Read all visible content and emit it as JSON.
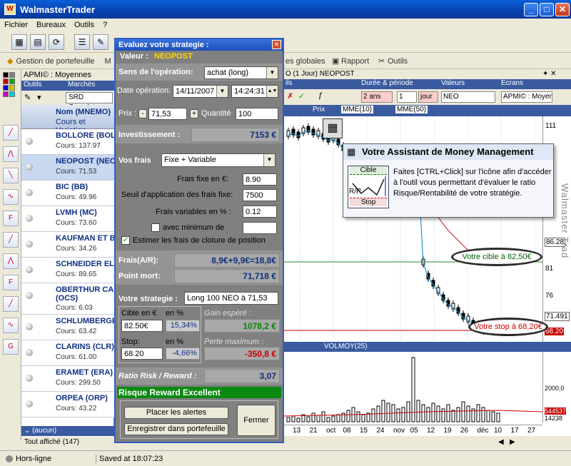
{
  "window": {
    "title": "WalmasterTrader"
  },
  "menu": [
    "Fichier",
    "Bureaux",
    "Outils",
    "?"
  ],
  "toolbar2": {
    "gestion": "Gestion de portefeuille",
    "m": "M",
    "vues": "es globales",
    "rapport": "Rapport",
    "outils": "Outils"
  },
  "list": {
    "header": "APMI© : Moyennes Mobiles (",
    "tabs": [
      "Outils",
      "Marchés"
    ],
    "market": "SRD Complet",
    "col1": "Nom (MNEMO)",
    "col2": "Cours et Variation",
    "rows": [
      {
        "name": "BOLLORE (BOL)",
        "cours": "Cours: 137.97"
      },
      {
        "name": "NEOPOST (NEO)",
        "cours": "Cours: 71.53"
      },
      {
        "name": "BIC (BB)",
        "cours": "Cours: 49.96"
      },
      {
        "name": "LVMH (MC)",
        "cours": "Cours: 73.60"
      },
      {
        "name": "KAUFMAN ET BRO",
        "cours": "Cours: 34.26"
      },
      {
        "name": "SCHNEIDER ELEC",
        "cours": "Cours: 89.65"
      },
      {
        "name": "OBERTHUR CARD",
        "name2": "(OCS)",
        "cours": "Cours: 6.03"
      },
      {
        "name": "SCHLUMBERGER",
        "cours": "Cours: 63.42"
      },
      {
        "name": "CLARINS (CLR)",
        "cours": "Cours: 61.00"
      },
      {
        "name": "ERAMET (ERA)",
        "cours": "Cours: 299.50"
      },
      {
        "name": "ORPEA (ORP)",
        "cours": "Cours: 43.22"
      }
    ],
    "footer_filter": "(aucun)",
    "footer_count": "Tout affiché (147)"
  },
  "status": {
    "connection": "Hors-ligne",
    "saved": "Saved at 18:07:23"
  },
  "chart": {
    "header": "O (1 Jour) NEOPOST",
    "tabs": [
      "ils",
      "Durée & période",
      "Valeurs",
      "Ecrans"
    ],
    "periode": "2 ans",
    "unit_value": "1",
    "unit": "jour",
    "valeur": "NEO",
    "ecran": "APMI© : Moyenne",
    "legend": [
      "Prix",
      "MME(10)",
      "MME(50)"
    ],
    "price_ticks": [
      "111",
      "86.28",
      "81",
      "76",
      "71.491",
      "68.20"
    ],
    "vol_label": "VOLMOY(25)",
    "vol_ticks": [
      "2000,0",
      "544537",
      "14238"
    ],
    "x_ticks": [
      "13",
      "21",
      "oct",
      "08",
      "15",
      "24",
      "nov",
      "05",
      "12",
      "19",
      "26",
      "déc",
      "10",
      "17",
      "27"
    ],
    "watermark": "Walmaster Trad",
    "cible_oval": "Votre cible à 82,50€",
    "stop_oval": "Votre stop à 68,20€"
  },
  "tooltip": {
    "title": "Votre Assistant de Money Management",
    "cible": "Cible",
    "rr": "R/R",
    "stop": "Stop",
    "text": "Faites [CTRL+Click] sur l'icône afin d'accéder à l'outil vous permettant d'évaluer le ratio Risque/Rentabilité de votre stratégie."
  },
  "dialog": {
    "title": "Evaluez votre strategie :",
    "valeur_label": "Valeur :",
    "valeur": "NEOPOST",
    "sens_label": "Sens de l'opération:",
    "sens": "achat (long)",
    "date_label": "Date opération:",
    "date": "14/11/2007",
    "time": "14:24:31",
    "prix_label": "Prix :",
    "prix": "71,53",
    "quantite_label": "Quantité",
    "quantite": "100",
    "invest_label": "Investissement :",
    "invest": "7153 €",
    "frais_label": "Vos frais",
    "frais_type": "Fixe + Variable",
    "frais_fixe_label": "Frais fixe en €:",
    "frais_fixe": "8.90",
    "seuil_label": "Seuil d'application des frais fixe:",
    "seuil": "7500",
    "frais_var_label": "Frais variables en % :",
    "frais_var": "0.12",
    "minimum_label": "avec minimum de",
    "estimer_label": "Estimer les frais de cloture de position",
    "frais_ar_label": "Frais(A/R):",
    "frais_ar": "8,9€+9,9€=18,8€",
    "point_mort_label": "Point mort:",
    "point_mort": "71,718 €",
    "strategie_label": "Votre strategie :",
    "strategie": "Long 100 NEO à 71,53",
    "cible_label": "Cible en €",
    "en_pct": "en %",
    "cible": "82.50€",
    "cible_pct": "15,34%",
    "gain_label": "Gain espéré :",
    "gain": "1078,2 €",
    "stop_label": "Stop:",
    "stop": "68.20",
    "stop_pct": "-4,66%",
    "perte_label": "Perte maximum :",
    "perte": "-350,8 €",
    "ratio_label": "Ratio Risk / Reward :",
    "ratio": "3,07",
    "verdict": "Risque Reward Excellent",
    "btn_alertes": "Placer les alertes",
    "btn_portefeuille": "Enregistrer dans portefeuille",
    "btn_fermer": "Fermer"
  }
}
